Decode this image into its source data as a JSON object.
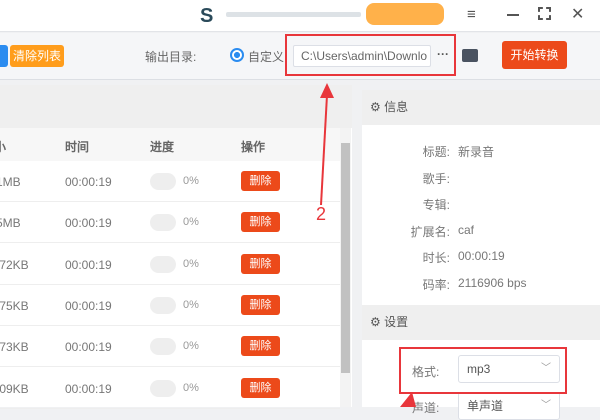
{
  "titlebar": {
    "menu_icon": "menu-icon",
    "minimize_icon": "minimize-icon",
    "maximize_icon": "maximize-icon",
    "close_icon": "close-icon"
  },
  "toolbar": {
    "clear_list": "清除列表",
    "output_dir_label": "输出目录:",
    "custom_label": "自定义",
    "output_path": "C:\\Users\\admin\\Downlo",
    "more": "···",
    "start_convert": "开始转换"
  },
  "table": {
    "columns": [
      "小",
      "时间",
      "进度",
      "操作"
    ],
    "rows": [
      {
        "size": "1MB",
        "time": "00:00:19",
        "progress": "0%",
        "action": "删除"
      },
      {
        "size": "5MB",
        "time": "00:00:19",
        "progress": "0%",
        "action": "删除"
      },
      {
        "size": ".72KB",
        "time": "00:00:19",
        "progress": "0%",
        "action": "删除"
      },
      {
        "size": ".75KB",
        "time": "00:00:19",
        "progress": "0%",
        "action": "删除"
      },
      {
        "size": ".73KB",
        "time": "00:00:19",
        "progress": "0%",
        "action": "删除"
      },
      {
        "size": ".09KB",
        "time": "00:00:19",
        "progress": "0%",
        "action": "删除"
      }
    ]
  },
  "info": {
    "header": "信息",
    "rows": [
      {
        "k": "标题:",
        "v": "新录音"
      },
      {
        "k": "歌手:",
        "v": ""
      },
      {
        "k": "专辑:",
        "v": ""
      },
      {
        "k": "扩展名:",
        "v": "caf"
      },
      {
        "k": "时长:",
        "v": "00:00:19"
      },
      {
        "k": "码率:",
        "v": "2116906 bps"
      }
    ]
  },
  "settings": {
    "header": "设置",
    "format_label": "格式:",
    "format_value": "mp3",
    "channel_label": "声道:",
    "channel_value": "单声道"
  },
  "annotation": {
    "number": "2"
  },
  "colors": {
    "accent_red": "#ec4a1a",
    "orange": "#ff9d1c",
    "blue": "#2b8cf0",
    "annotation": "#e8363b"
  }
}
